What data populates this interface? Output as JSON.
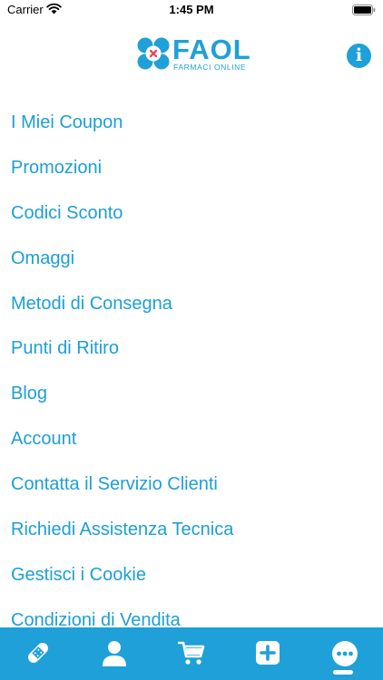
{
  "status_bar": {
    "carrier": "Carrier",
    "time": "1:45 PM"
  },
  "header": {
    "logo_title": "FAOL",
    "logo_subtitle": "FARMACI ONLINE",
    "info_icon": "i"
  },
  "menu": {
    "items": [
      {
        "label": "I Miei Coupon"
      },
      {
        "label": "Promozioni"
      },
      {
        "label": "Codici Sconto"
      },
      {
        "label": "Omaggi"
      },
      {
        "label": "Metodi di Consegna"
      },
      {
        "label": "Punti di Ritiro"
      },
      {
        "label": "Blog"
      },
      {
        "label": "Account"
      },
      {
        "label": "Contatta il Servizio Clienti"
      },
      {
        "label": "Richiedi Assistenza Tecnica"
      },
      {
        "label": "Gestisci i Cookie"
      },
      {
        "label": "Condizioni di Vendita"
      }
    ]
  },
  "tab_bar": {
    "tabs": [
      {
        "icon": "bandage-icon"
      },
      {
        "icon": "person-icon"
      },
      {
        "icon": "cart-icon"
      },
      {
        "icon": "plus-square-icon"
      },
      {
        "icon": "more-icon",
        "selected": true
      }
    ]
  },
  "colors": {
    "brand": "#1fa0d8",
    "menu_text": "#1c9fd6",
    "logo_cross": "#e54b5a"
  }
}
